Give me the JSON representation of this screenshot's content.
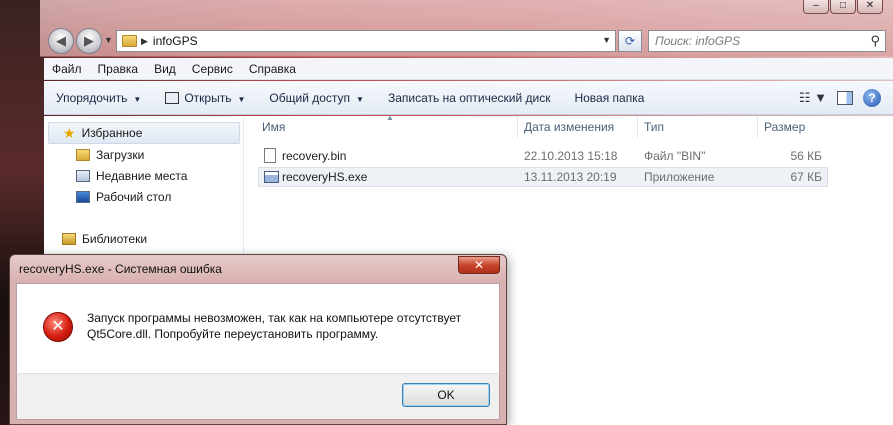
{
  "window": {
    "caption_buttons": [
      "–",
      "□",
      "✕"
    ]
  },
  "address_bar": {
    "path": "infoGPS",
    "search_placeholder": "Поиск: infoGPS"
  },
  "menu": [
    "Файл",
    "Правка",
    "Вид",
    "Сервис",
    "Справка"
  ],
  "toolbar": {
    "organize": "Упорядочить",
    "open": "Открыть",
    "share": "Общий доступ",
    "burn": "Записать на оптический диск",
    "new_folder": "Новая папка"
  },
  "nav_pane": {
    "favorites": "Избранное",
    "downloads": "Загрузки",
    "recent": "Недавние места",
    "desktop": "Рабочий стол",
    "libraries": "Библиотеки"
  },
  "columns": {
    "name": "Имя",
    "date": "Дата изменения",
    "type": "Тип",
    "size": "Размер"
  },
  "files": [
    {
      "name": "recovery.bin",
      "date": "22.10.2013 15:18",
      "type": "Файл \"BIN\"",
      "size": "56 КБ"
    },
    {
      "name": "recoveryHS.exe",
      "date": "13.11.2013 20:19",
      "type": "Приложение",
      "size": "67 КБ"
    }
  ],
  "dialog": {
    "title": "recoveryHS.exe - Системная ошибка",
    "message": "Запуск программы невозможен, так как на компьютере отсутствует Qt5Core.dll. Попробуйте переустановить программу.",
    "ok": "OK"
  }
}
